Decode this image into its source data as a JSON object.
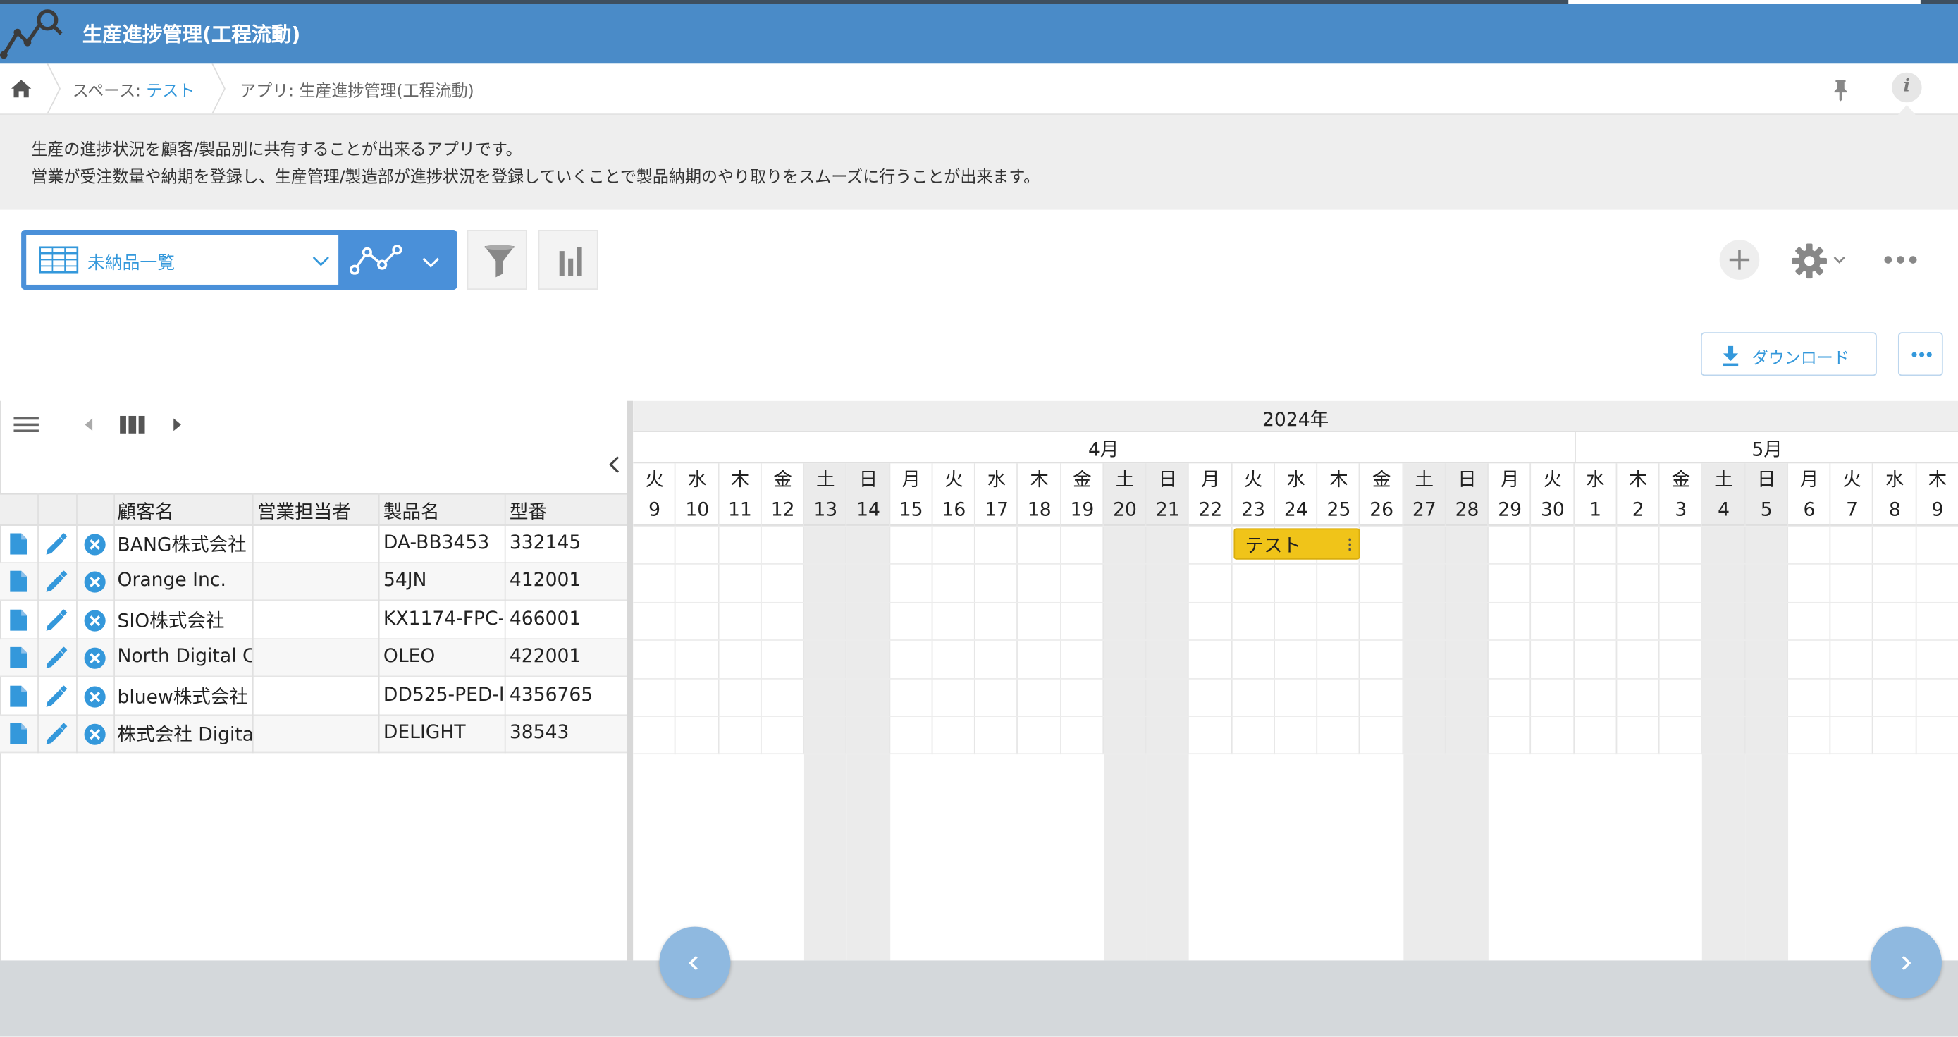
{
  "app": {
    "title": "生産進捗管理(工程流動)"
  },
  "breadcrumb": {
    "space_prefix": "スペース: ",
    "space_name": "テスト",
    "app_label": "アプリ: 生産進捗管理(工程流動)"
  },
  "description": {
    "line1": "生産の進捗状況を顧客/製品別に共有することが出来るアプリです。",
    "line2": "営業が受注数量や納期を登録し、生産管理/製造部が進捗状況を登録していくことで製品納期のやり取りをスムーズに行うことが出来ます。"
  },
  "toolbar": {
    "view_name": "未納品一覧",
    "download_label": "ダウンロード"
  },
  "table": {
    "columns": [
      "顧客名",
      "営業担当者",
      "製品名",
      "型番"
    ],
    "rows": [
      {
        "customer": "BANG株式会社",
        "sales": "",
        "product": "DA-BB3453",
        "model": "332145"
      },
      {
        "customer": "Orange Inc.",
        "sales": "",
        "product": "54JN",
        "model": "412001"
      },
      {
        "customer": "SIO株式会社",
        "sales": "",
        "product": "KX1174-FPC-",
        "model": "466001"
      },
      {
        "customer": "North Digital Co",
        "sales": "",
        "product": "OLEO",
        "model": "422001"
      },
      {
        "customer": "bluew株式会社",
        "sales": "",
        "product": "DD525-PED-l",
        "model": "4356765"
      },
      {
        "customer": "株式会社 Digita",
        "sales": "",
        "product": "DELIGHT",
        "model": "38543"
      }
    ]
  },
  "gantt": {
    "year": "2024年",
    "months": [
      {
        "label": "4月"
      },
      {
        "label": "5月"
      }
    ],
    "days": [
      {
        "wd": "火",
        "d": "9"
      },
      {
        "wd": "水",
        "d": "10"
      },
      {
        "wd": "木",
        "d": "11"
      },
      {
        "wd": "金",
        "d": "12"
      },
      {
        "wd": "土",
        "d": "13",
        "we": true
      },
      {
        "wd": "日",
        "d": "14",
        "we": true
      },
      {
        "wd": "月",
        "d": "15"
      },
      {
        "wd": "火",
        "d": "16"
      },
      {
        "wd": "水",
        "d": "17"
      },
      {
        "wd": "木",
        "d": "18"
      },
      {
        "wd": "金",
        "d": "19"
      },
      {
        "wd": "土",
        "d": "20",
        "we": true
      },
      {
        "wd": "日",
        "d": "21",
        "we": true
      },
      {
        "wd": "月",
        "d": "22"
      },
      {
        "wd": "火",
        "d": "23"
      },
      {
        "wd": "水",
        "d": "24"
      },
      {
        "wd": "木",
        "d": "25"
      },
      {
        "wd": "金",
        "d": "26"
      },
      {
        "wd": "土",
        "d": "27",
        "we": true
      },
      {
        "wd": "日",
        "d": "28",
        "we": true
      },
      {
        "wd": "月",
        "d": "29"
      },
      {
        "wd": "火",
        "d": "30"
      },
      {
        "wd": "水",
        "d": "1"
      },
      {
        "wd": "木",
        "d": "2"
      },
      {
        "wd": "金",
        "d": "3"
      },
      {
        "wd": "土",
        "d": "4",
        "we": true
      },
      {
        "wd": "日",
        "d": "5",
        "we": true
      },
      {
        "wd": "月",
        "d": "6"
      },
      {
        "wd": "火",
        "d": "7"
      },
      {
        "wd": "水",
        "d": "8"
      },
      {
        "wd": "木",
        "d": "9"
      }
    ],
    "bar": {
      "label": "テスト",
      "start": "2024-04-23",
      "end": "2024-04-25",
      "color": "#f0c419"
    }
  },
  "colors": {
    "header": "#4a8bc8",
    "accent": "#3498db",
    "weekend": "#ebebeb"
  },
  "icons": [
    "home-icon",
    "pin-icon",
    "info-icon",
    "table-view-icon",
    "graph-icon",
    "filter-icon",
    "chart-icon",
    "plus-icon",
    "gear-icon",
    "more-icon",
    "download-icon",
    "document-icon",
    "edit-icon",
    "delete-icon"
  ]
}
